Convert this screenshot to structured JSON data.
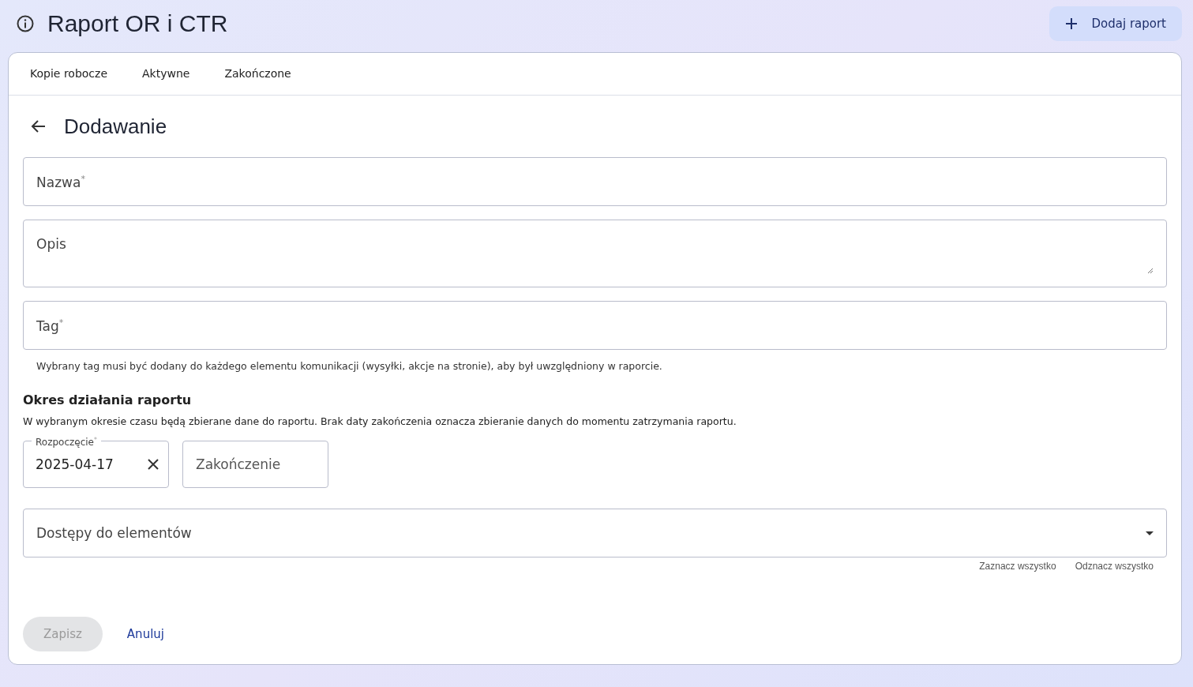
{
  "header": {
    "title": "Raport OR i CTR",
    "add_button": "Dodaj raport"
  },
  "tabs": [
    {
      "label": "Kopie robocze",
      "selected": false
    },
    {
      "label": "Aktywne",
      "selected": false
    },
    {
      "label": "Zakończone",
      "selected": false
    }
  ],
  "form": {
    "title": "Dodawanie",
    "name_field": {
      "placeholder": "Nazwa$^{*}$"
    },
    "description_field": {
      "placeholder": "Opis"
    },
    "tag_field": {
      "placeholder": "Tag$^{*}$",
      "hint": "Wybrany tag musi być dodany do każdego elementu komunikacji (wysyłki, akcje na stronie), aby był uwzględniony w raporcie."
    },
    "period": {
      "heading": "Okres działania raportu",
      "description": "W wybranym okresie czasu będą zbierane dane do raportu. Brak daty zakończenia oznacza zbieranie danych do momentu zatrzymania raportu.",
      "start": {
        "label": "Rozpoczęcie$^{*}$",
        "value": "2025-04-17"
      },
      "end": {
        "placeholder": "Zakończenie"
      }
    },
    "access_select": {
      "placeholder": "Dostępy do elementów"
    },
    "select_all": "Zaznacz wszystko",
    "deselect_all": "Odznacz wszystko",
    "save_button": {
      "label": "Zapisz",
      "disabled": true
    },
    "cancel_link": "Anuluj"
  }
}
